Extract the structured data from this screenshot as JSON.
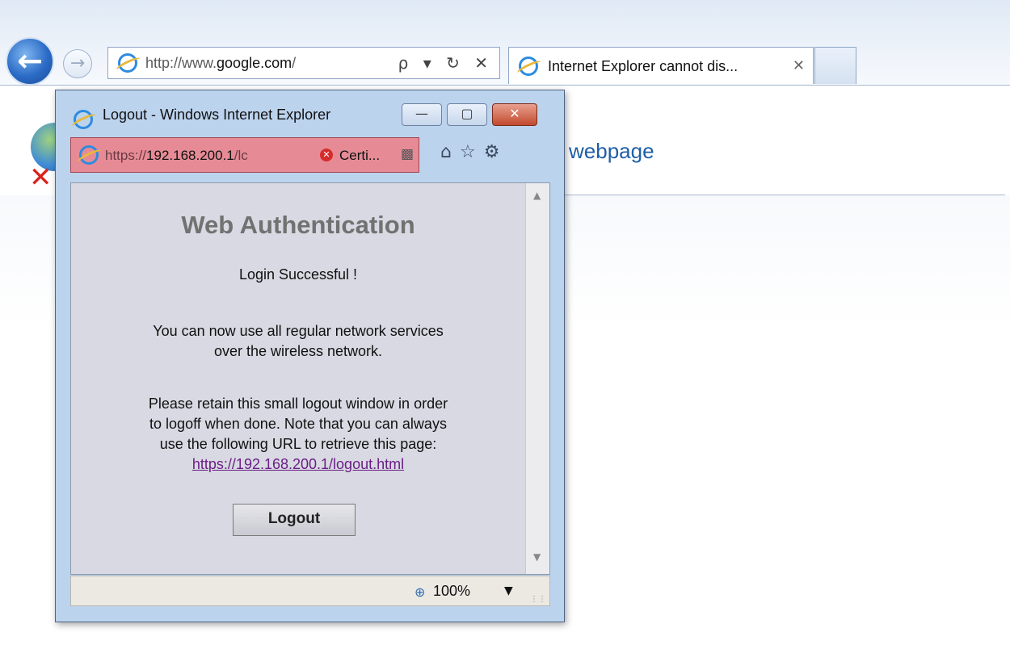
{
  "browser": {
    "address_prefix": "http://www.",
    "address_domain": "google.com",
    "address_suffix": "/",
    "address_icons": "ρ ▾ ↻ ✕",
    "tab_title": "Internet Explorer cannot dis...",
    "tab_close": "✕"
  },
  "background_page": {
    "heading": "webpage"
  },
  "popup": {
    "title": "Logout - Windows Internet Explorer",
    "url_prefix": "https://",
    "url_host": "192.168.200.1",
    "url_suffix": "/lc",
    "cert_label": "Certi...",
    "content": {
      "heading": "Web Authentication",
      "success": "Login Successful !",
      "info_line1": "You can now use all regular network services",
      "info_line2": "over the wireless network.",
      "retain_line1": "Please retain this small logout window in order",
      "retain_line2": "to logoff when done. Note that you can always",
      "retain_line3": "use the following URL to retrieve this page:",
      "logout_url": "https://192.168.200.1/logout.html",
      "logout_button": "Logout"
    },
    "status": {
      "zoom": "100%"
    }
  },
  "icons": {
    "back": "back-arrow-icon",
    "forward": "forward-arrow-icon",
    "home": "home-icon",
    "favorites": "star-icon",
    "tools": "gear-icon",
    "certificate_error": "certificate-error-icon",
    "zoom": "zoom-icon"
  },
  "colors": {
    "address_error_bg": "#e68b96",
    "link": "#6b1f86",
    "page_heading": "#1f5fa6"
  }
}
